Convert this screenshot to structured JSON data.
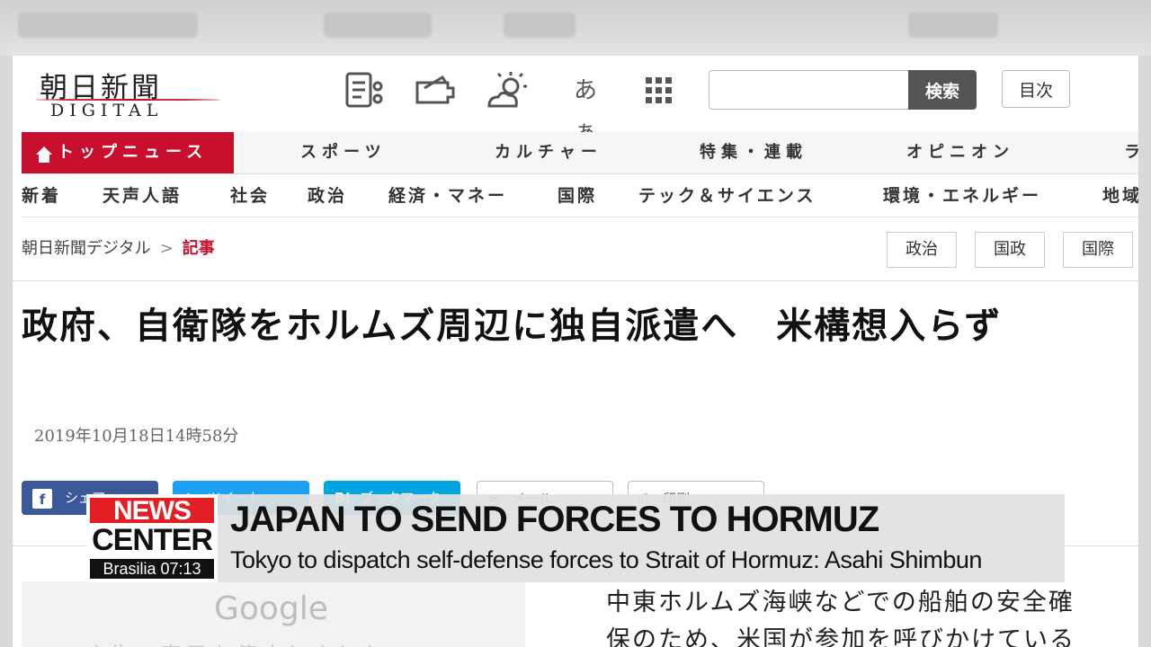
{
  "site": {
    "logo_jp": "朝日新聞",
    "logo_en": "DIGITAL",
    "search_button": "検索",
    "index_button": "目次",
    "kana_icon_label": "あぁ"
  },
  "nav_primary": {
    "active": "トップニュース",
    "items": [
      "スポーツ",
      "カルチャー",
      "特集・連載",
      "オピニオン",
      "ラ"
    ]
  },
  "nav_secondary": {
    "items": [
      "新着",
      "天声人語",
      "社会",
      "政治",
      "経済・マネー",
      "国際",
      "テック＆サイエンス",
      "環境・エネルギー",
      "地域"
    ]
  },
  "breadcrumb": {
    "home": "朝日新聞デジタル",
    "separator": ">",
    "current": "記事"
  },
  "tags": [
    "政治",
    "国政",
    "国際"
  ],
  "article": {
    "headline": "政府、自衛隊をホルムズ周辺に独自派遣へ　米構想入らず",
    "date": "2019年10月18日14時58分",
    "share": {
      "facebook": "シェア",
      "twitter": "ツイート",
      "hatena": "ブックマーク",
      "mail": "メール",
      "print": "印刷"
    },
    "body_lines": [
      "中東ホルムズ海峡などでの船舶の安全確",
      "保のため、米国が参加を呼びかけている"
    ]
  },
  "ad": {
    "brand": "Google",
    "text": "この広告の表示を停止しました"
  },
  "broadcast": {
    "logo_top": "NEWS",
    "logo_bottom": "CENTER",
    "location_time": "Brasilia 07:13",
    "title": "JAPAN TO SEND FORCES TO HORMUZ",
    "subtitle": "Tokyo to dispatch self-defense forces to Strait of Hormuz: Asahi Shimbun"
  },
  "colors": {
    "brand_red": "#c8102e",
    "news_red": "#e31e24",
    "facebook": "#3b5998",
    "twitter": "#1da1f2",
    "hatena": "#00a4de"
  }
}
